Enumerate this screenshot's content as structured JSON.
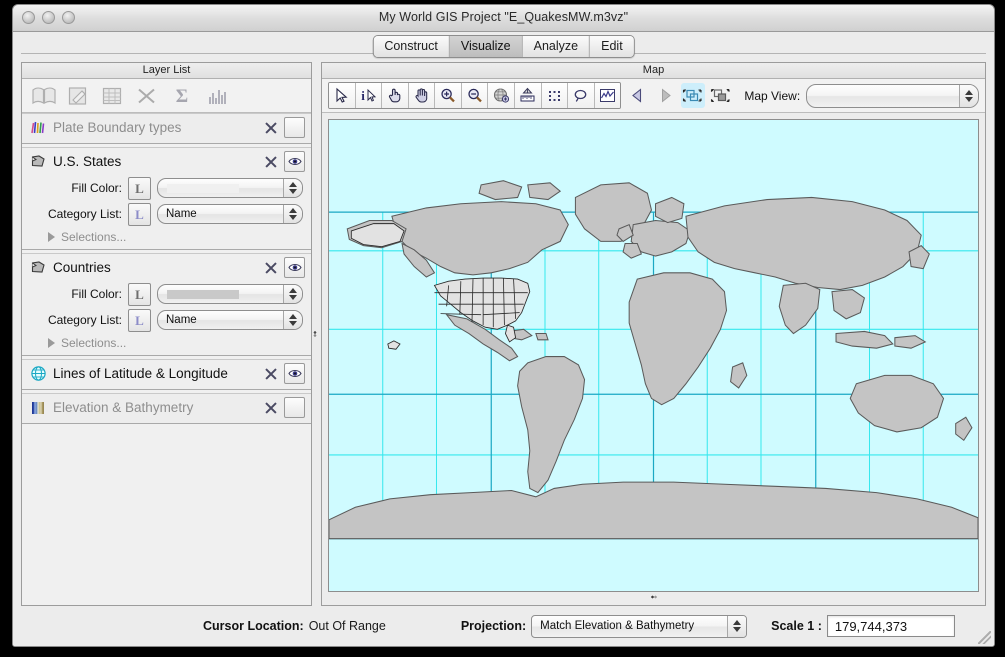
{
  "window": {
    "title": "My World GIS Project \"E_QuakesMW.m3vz\"",
    "controls": [
      "close",
      "minimize",
      "zoom"
    ]
  },
  "tabs": [
    {
      "label": "Construct",
      "active": false
    },
    {
      "label": "Visualize",
      "active": true
    },
    {
      "label": "Analyze",
      "active": false
    },
    {
      "label": "Edit",
      "active": false
    }
  ],
  "layer_panel": {
    "title": "Layer List",
    "toolbar": [
      {
        "name": "open-library-icon",
        "tooltip": "Library"
      },
      {
        "name": "edit-layer-icon",
        "tooltip": "Edit Layer"
      },
      {
        "name": "table-icon",
        "tooltip": "Table"
      },
      {
        "name": "delete-x-icon",
        "tooltip": "Delete"
      },
      {
        "name": "sigma-icon",
        "tooltip": "Summarize"
      },
      {
        "name": "bar-chart-icon",
        "tooltip": "Chart"
      }
    ],
    "layers": [
      {
        "name": "Plate Boundary types",
        "icon": "plate-boundary-icon",
        "visible": false,
        "dimmed": true,
        "expanded": false,
        "rows": []
      },
      {
        "name": "U.S. States",
        "icon": "polygon-layer-icon",
        "visible": true,
        "dimmed": false,
        "expanded": true,
        "rows": [
          {
            "label": "Fill Color:",
            "legend": "L",
            "legend_style": "gray",
            "kind": "swatch",
            "value": "",
            "swatch_color": "#f0f0f0"
          },
          {
            "label": "Category List:",
            "legend": "L",
            "legend_style": "blue",
            "kind": "text",
            "value": "Name"
          }
        ],
        "selections_label": "Selections..."
      },
      {
        "name": "Countries",
        "icon": "polygon-layer-icon",
        "visible": true,
        "dimmed": false,
        "expanded": true,
        "rows": [
          {
            "label": "Fill Color:",
            "legend": "L",
            "legend_style": "gray",
            "kind": "swatch",
            "value": "",
            "swatch_color": "#c9c9c9"
          },
          {
            "label": "Category List:",
            "legend": "L",
            "legend_style": "blue",
            "kind": "text",
            "value": "Name"
          }
        ],
        "selections_label": "Selections..."
      },
      {
        "name": "Lines of Latitude & Longitude",
        "icon": "globe-grid-icon",
        "visible": true,
        "dimmed": false,
        "expanded": false,
        "rows": []
      },
      {
        "name": "Elevation & Bathymetry",
        "icon": "elevation-ramp-icon",
        "visible": false,
        "dimmed": true,
        "expanded": false,
        "rows": []
      }
    ]
  },
  "map_panel": {
    "title": "Map",
    "tools": [
      {
        "name": "select-arrow-tool",
        "active": false
      },
      {
        "name": "identify-info-tool",
        "active": false
      },
      {
        "name": "pointing-hand-tool",
        "active": false
      },
      {
        "name": "pan-hand-tool",
        "active": false
      },
      {
        "name": "zoom-in-tool",
        "active": false
      },
      {
        "name": "zoom-out-tool",
        "active": false
      },
      {
        "name": "globe-tool",
        "active": false
      },
      {
        "name": "measure-ruler-tool",
        "active": false
      },
      {
        "name": "marquee-select-tool",
        "active": false
      },
      {
        "name": "lasso-select-tool",
        "active": false
      },
      {
        "name": "graph-tool",
        "active": false
      }
    ],
    "nav": [
      {
        "name": "previous-view-button",
        "enabled": true,
        "selected": false
      },
      {
        "name": "next-view-button",
        "enabled": false,
        "selected": false
      },
      {
        "name": "zoom-to-all-layers-button",
        "enabled": true,
        "selected": true
      },
      {
        "name": "zoom-to-active-layer-button",
        "enabled": true,
        "selected": false
      }
    ],
    "map_view": {
      "label": "Map View:",
      "value": "",
      "placeholder": ""
    }
  },
  "status_bar": {
    "cursor_location_label": "Cursor Location:",
    "cursor_location_value": "Out Of Range",
    "projection_label": "Projection:",
    "projection_value": "Match Elevation & Bathymetry",
    "scale_label": "Scale 1 :",
    "scale_value": "179,744,373"
  },
  "map_render": {
    "ocean_color": "#cffbff",
    "land_color": "#c4c4c4",
    "land_stroke": "#5a5a5a",
    "states_fill": "#e2e2e2",
    "states_stroke": "#2a2a2a",
    "graticule_color": "#35e8ee",
    "graticule_major_color": "#1aa8c4",
    "meridian_spacing_deg": 30,
    "parallel_spacing_deg": 30
  }
}
